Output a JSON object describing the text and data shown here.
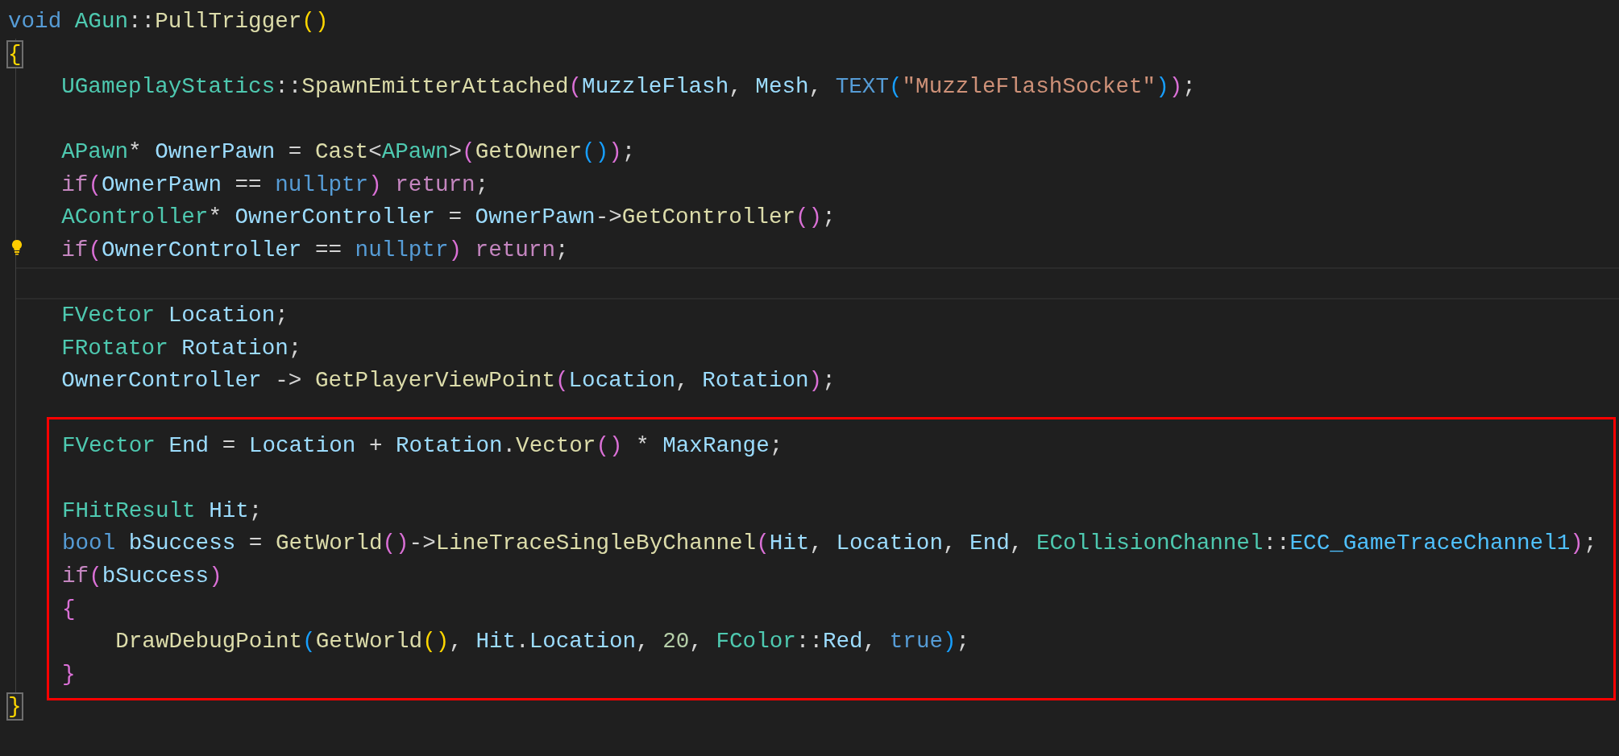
{
  "editor": {
    "blocks": [
      {
        "kind": "plain",
        "lines": [
          {
            "kind": "code",
            "current": false,
            "bracket_match": false,
            "lightbulb": false,
            "tokens": [
              {
                "text": "void ",
                "kind": "kw"
              },
              {
                "text": "AGun",
                "kind": "type"
              },
              {
                "text": "::",
                "kind": "op"
              },
              {
                "text": "PullTrigger",
                "kind": "fn"
              },
              {
                "text": "()",
                "kind": "b1"
              }
            ]
          },
          {
            "kind": "code",
            "current": false,
            "bracket_match": true,
            "lightbulb": false,
            "tokens": [
              {
                "text": "{",
                "kind": "b1"
              }
            ]
          },
          {
            "kind": "code",
            "current": false,
            "bracket_match": false,
            "lightbulb": false,
            "tokens": [
              {
                "text": "    UGameplayStatics",
                "kind": "type"
              },
              {
                "text": "::",
                "kind": "op"
              },
              {
                "text": "SpawnEmitterAttached",
                "kind": "fn"
              },
              {
                "text": "(",
                "kind": "b2"
              },
              {
                "text": "MuzzleFlash",
                "kind": "var"
              },
              {
                "text": ", ",
                "kind": "op"
              },
              {
                "text": "Mesh",
                "kind": "var"
              },
              {
                "text": ", ",
                "kind": "op"
              },
              {
                "text": "TEXT",
                "kind": "kw"
              },
              {
                "text": "(",
                "kind": "b3"
              },
              {
                "text": "\"MuzzleFlashSocket\"",
                "kind": "str"
              },
              {
                "text": ")",
                "kind": "b3"
              },
              {
                "text": ")",
                "kind": "b2"
              },
              {
                "text": ";",
                "kind": "op"
              }
            ]
          },
          {
            "kind": "blank",
            "current": false
          },
          {
            "kind": "code",
            "current": false,
            "bracket_match": false,
            "lightbulb": false,
            "tokens": [
              {
                "text": "    APawn",
                "kind": "type"
              },
              {
                "text": "* ",
                "kind": "op"
              },
              {
                "text": "OwnerPawn",
                "kind": "var"
              },
              {
                "text": " = ",
                "kind": "op"
              },
              {
                "text": "Cast",
                "kind": "fn"
              },
              {
                "text": "<",
                "kind": "op"
              },
              {
                "text": "APawn",
                "kind": "type"
              },
              {
                "text": ">",
                "kind": "op"
              },
              {
                "text": "(",
                "kind": "b2"
              },
              {
                "text": "GetOwner",
                "kind": "fn"
              },
              {
                "text": "()",
                "kind": "b3"
              },
              {
                "text": ")",
                "kind": "b2"
              },
              {
                "text": ";",
                "kind": "op"
              }
            ]
          },
          {
            "kind": "code",
            "current": false,
            "bracket_match": false,
            "lightbulb": false,
            "tokens": [
              {
                "text": "    if",
                "kind": "ctl"
              },
              {
                "text": "(",
                "kind": "b2"
              },
              {
                "text": "OwnerPawn",
                "kind": "var"
              },
              {
                "text": " == ",
                "kind": "op"
              },
              {
                "text": "nullptr",
                "kind": "kw"
              },
              {
                "text": ")",
                "kind": "b2"
              },
              {
                "text": " return",
                "kind": "ctl"
              },
              {
                "text": ";",
                "kind": "op"
              }
            ]
          },
          {
            "kind": "code",
            "current": false,
            "bracket_match": false,
            "lightbulb": false,
            "tokens": [
              {
                "text": "    AController",
                "kind": "type"
              },
              {
                "text": "* ",
                "kind": "op"
              },
              {
                "text": "OwnerController",
                "kind": "var"
              },
              {
                "text": " = ",
                "kind": "op"
              },
              {
                "text": "OwnerPawn",
                "kind": "var"
              },
              {
                "text": "->",
                "kind": "op"
              },
              {
                "text": "GetController",
                "kind": "fn"
              },
              {
                "text": "()",
                "kind": "b2"
              },
              {
                "text": ";",
                "kind": "op"
              }
            ]
          },
          {
            "kind": "code",
            "current": false,
            "bracket_match": false,
            "lightbulb": true,
            "tokens": [
              {
                "text": "    if",
                "kind": "ctl"
              },
              {
                "text": "(",
                "kind": "b2"
              },
              {
                "text": "OwnerController",
                "kind": "var"
              },
              {
                "text": " == ",
                "kind": "op"
              },
              {
                "text": "nullptr",
                "kind": "kw"
              },
              {
                "text": ")",
                "kind": "b2"
              },
              {
                "text": " return",
                "kind": "ctl"
              },
              {
                "text": ";",
                "kind": "op"
              }
            ]
          },
          {
            "kind": "blank",
            "current": true
          },
          {
            "kind": "code",
            "current": false,
            "bracket_match": false,
            "lightbulb": false,
            "tokens": [
              {
                "text": "    FVector",
                "kind": "type"
              },
              {
                "text": " Location",
                "kind": "var"
              },
              {
                "text": ";",
                "kind": "op"
              }
            ]
          },
          {
            "kind": "code",
            "current": false,
            "bracket_match": false,
            "lightbulb": false,
            "tokens": [
              {
                "text": "    FRotator",
                "kind": "type"
              },
              {
                "text": " Rotation",
                "kind": "var"
              },
              {
                "text": ";",
                "kind": "op"
              }
            ]
          },
          {
            "kind": "code",
            "current": false,
            "bracket_match": false,
            "lightbulb": false,
            "tokens": [
              {
                "text": "    OwnerController",
                "kind": "var"
              },
              {
                "text": " -> ",
                "kind": "op"
              },
              {
                "text": "GetPlayerViewPoint",
                "kind": "fn"
              },
              {
                "text": "(",
                "kind": "b2"
              },
              {
                "text": "Location",
                "kind": "var"
              },
              {
                "text": ", ",
                "kind": "op"
              },
              {
                "text": "Rotation",
                "kind": "var"
              },
              {
                "text": ")",
                "kind": "b2"
              },
              {
                "text": ";",
                "kind": "op"
              }
            ]
          }
        ]
      },
      {
        "kind": "highlight",
        "lines": [
          {
            "kind": "code",
            "current": false,
            "bracket_match": false,
            "lightbulb": false,
            "tokens": [
              {
                "text": "FVector",
                "kind": "type"
              },
              {
                "text": " End",
                "kind": "var"
              },
              {
                "text": " = ",
                "kind": "op"
              },
              {
                "text": "Location",
                "kind": "var"
              },
              {
                "text": " + ",
                "kind": "op"
              },
              {
                "text": "Rotation",
                "kind": "var"
              },
              {
                "text": ".",
                "kind": "op"
              },
              {
                "text": "Vector",
                "kind": "fn"
              },
              {
                "text": "()",
                "kind": "b2"
              },
              {
                "text": " * ",
                "kind": "op"
              },
              {
                "text": "MaxRange",
                "kind": "var"
              },
              {
                "text": ";",
                "kind": "op"
              }
            ]
          },
          {
            "kind": "blank",
            "current": false
          },
          {
            "kind": "code",
            "current": false,
            "bracket_match": false,
            "lightbulb": false,
            "tokens": [
              {
                "text": "FHitResult",
                "kind": "type"
              },
              {
                "text": " Hit",
                "kind": "var"
              },
              {
                "text": ";",
                "kind": "op"
              }
            ]
          },
          {
            "kind": "code",
            "current": false,
            "bracket_match": false,
            "lightbulb": false,
            "tokens": [
              {
                "text": "bool ",
                "kind": "kw"
              },
              {
                "text": "bSuccess",
                "kind": "var"
              },
              {
                "text": " = ",
                "kind": "op"
              },
              {
                "text": "GetWorld",
                "kind": "fn"
              },
              {
                "text": "()",
                "kind": "b2"
              },
              {
                "text": "->",
                "kind": "op"
              },
              {
                "text": "LineTraceSingleByChannel",
                "kind": "fn"
              },
              {
                "text": "(",
                "kind": "b2"
              },
              {
                "text": "Hit",
                "kind": "var"
              },
              {
                "text": ", ",
                "kind": "op"
              },
              {
                "text": "Location",
                "kind": "var"
              },
              {
                "text": ", ",
                "kind": "op"
              },
              {
                "text": "End",
                "kind": "var"
              },
              {
                "text": ", ",
                "kind": "op"
              },
              {
                "text": "ECollisionChannel",
                "kind": "type"
              },
              {
                "text": "::",
                "kind": "op"
              },
              {
                "text": "ECC_GameTraceChannel1",
                "kind": "enum"
              },
              {
                "text": ")",
                "kind": "b2"
              },
              {
                "text": ";",
                "kind": "op"
              }
            ]
          },
          {
            "kind": "code",
            "current": false,
            "bracket_match": false,
            "lightbulb": false,
            "tokens": [
              {
                "text": "if",
                "kind": "ctl"
              },
              {
                "text": "(",
                "kind": "b2"
              },
              {
                "text": "bSuccess",
                "kind": "var"
              },
              {
                "text": ")",
                "kind": "b2"
              }
            ]
          },
          {
            "kind": "code",
            "current": false,
            "bracket_match": false,
            "lightbulb": false,
            "tokens": [
              {
                "text": "{",
                "kind": "b2"
              }
            ]
          },
          {
            "kind": "code",
            "current": false,
            "bracket_match": false,
            "lightbulb": false,
            "tokens": [
              {
                "text": "    DrawDebugPoint",
                "kind": "fn"
              },
              {
                "text": "(",
                "kind": "b3"
              },
              {
                "text": "GetWorld",
                "kind": "fn"
              },
              {
                "text": "()",
                "kind": "b1"
              },
              {
                "text": ", ",
                "kind": "op"
              },
              {
                "text": "Hit",
                "kind": "var"
              },
              {
                "text": ".",
                "kind": "op"
              },
              {
                "text": "Location",
                "kind": "var"
              },
              {
                "text": ", ",
                "kind": "op"
              },
              {
                "text": "20",
                "kind": "num"
              },
              {
                "text": ", ",
                "kind": "op"
              },
              {
                "text": "FColor",
                "kind": "type"
              },
              {
                "text": "::",
                "kind": "op"
              },
              {
                "text": "Red",
                "kind": "var"
              },
              {
                "text": ", ",
                "kind": "op"
              },
              {
                "text": "true",
                "kind": "kw"
              },
              {
                "text": ")",
                "kind": "b3"
              },
              {
                "text": ";",
                "kind": "op"
              }
            ]
          },
          {
            "kind": "code",
            "current": false,
            "bracket_match": false,
            "lightbulb": false,
            "tokens": [
              {
                "text": "}",
                "kind": "b2"
              }
            ]
          }
        ]
      },
      {
        "kind": "plain",
        "lines": [
          {
            "kind": "code",
            "current": false,
            "bracket_match": true,
            "lightbulb": false,
            "tokens": [
              {
                "text": "}",
                "kind": "b1"
              }
            ]
          }
        ]
      }
    ]
  }
}
